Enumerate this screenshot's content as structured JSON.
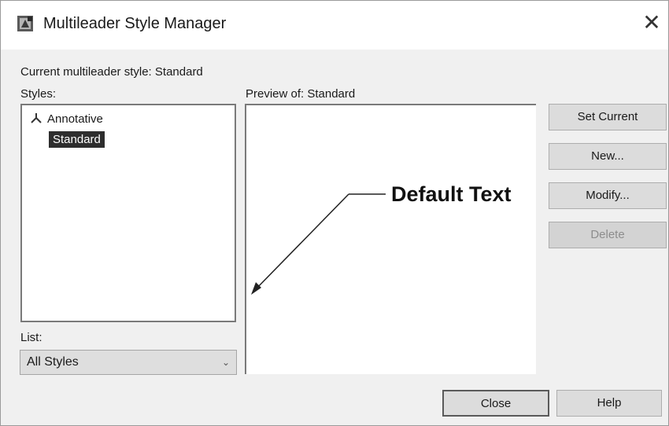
{
  "window": {
    "title": "Multileader Style Manager",
    "icon": "autocad-app-icon",
    "close_glyph": "✕"
  },
  "current_style": "Current multileader style: Standard",
  "styles_label": "Styles:",
  "styles": [
    {
      "label": "Annotative",
      "icon": "annotative-icon"
    },
    {
      "label": "Standard",
      "selected": true
    }
  ],
  "preview_label": "Preview of: Standard",
  "preview_text": "Default Text",
  "list_label": "List:",
  "list_select": {
    "value": "All Styles",
    "chevron": "⌄"
  },
  "buttons": {
    "set_current": "Set Current",
    "new": "New...",
    "modify": "Modify...",
    "delete": "Delete",
    "close": "Close",
    "help": "Help"
  },
  "colors": {
    "selection_bg": "#2e2e2e",
    "button_bg": "#dcdcdc",
    "dialog_bg": "#f0f0f0"
  }
}
